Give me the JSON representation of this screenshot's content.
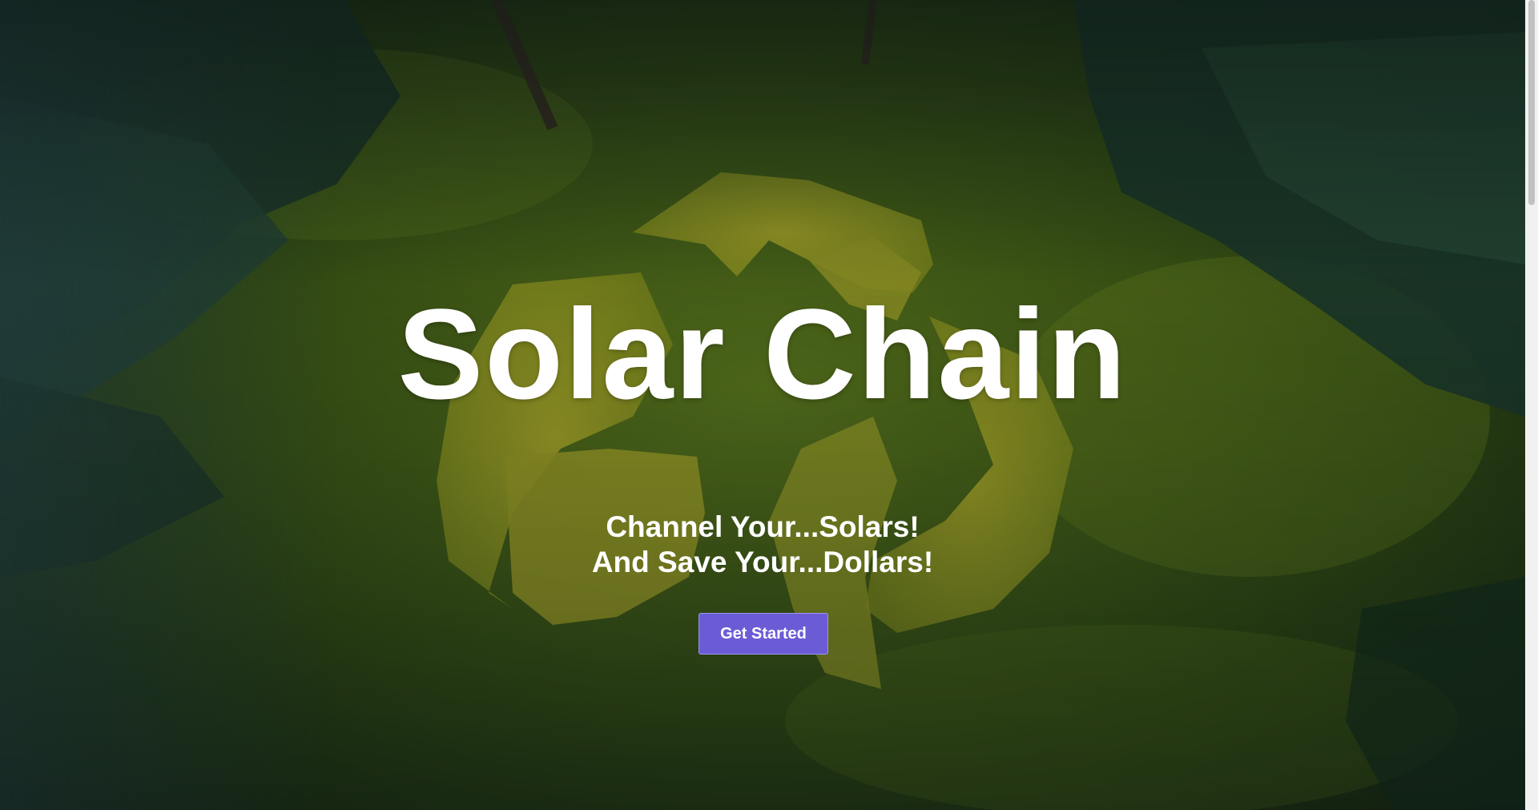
{
  "hero": {
    "title": "Solar Chain",
    "tagline_line1": "Channel Your...Solars!",
    "tagline_line2": "And Save Your...Dollars!",
    "cta_label": "Get Started"
  },
  "colors": {
    "button_background": "#6b5cd6",
    "button_border": "#9e95f0",
    "text": "#ffffff",
    "grass": "#4f6a1c",
    "recycle_hedge": "#a9ab2a"
  },
  "icons": {
    "background_motif": "recycle-symbol-hedge"
  }
}
